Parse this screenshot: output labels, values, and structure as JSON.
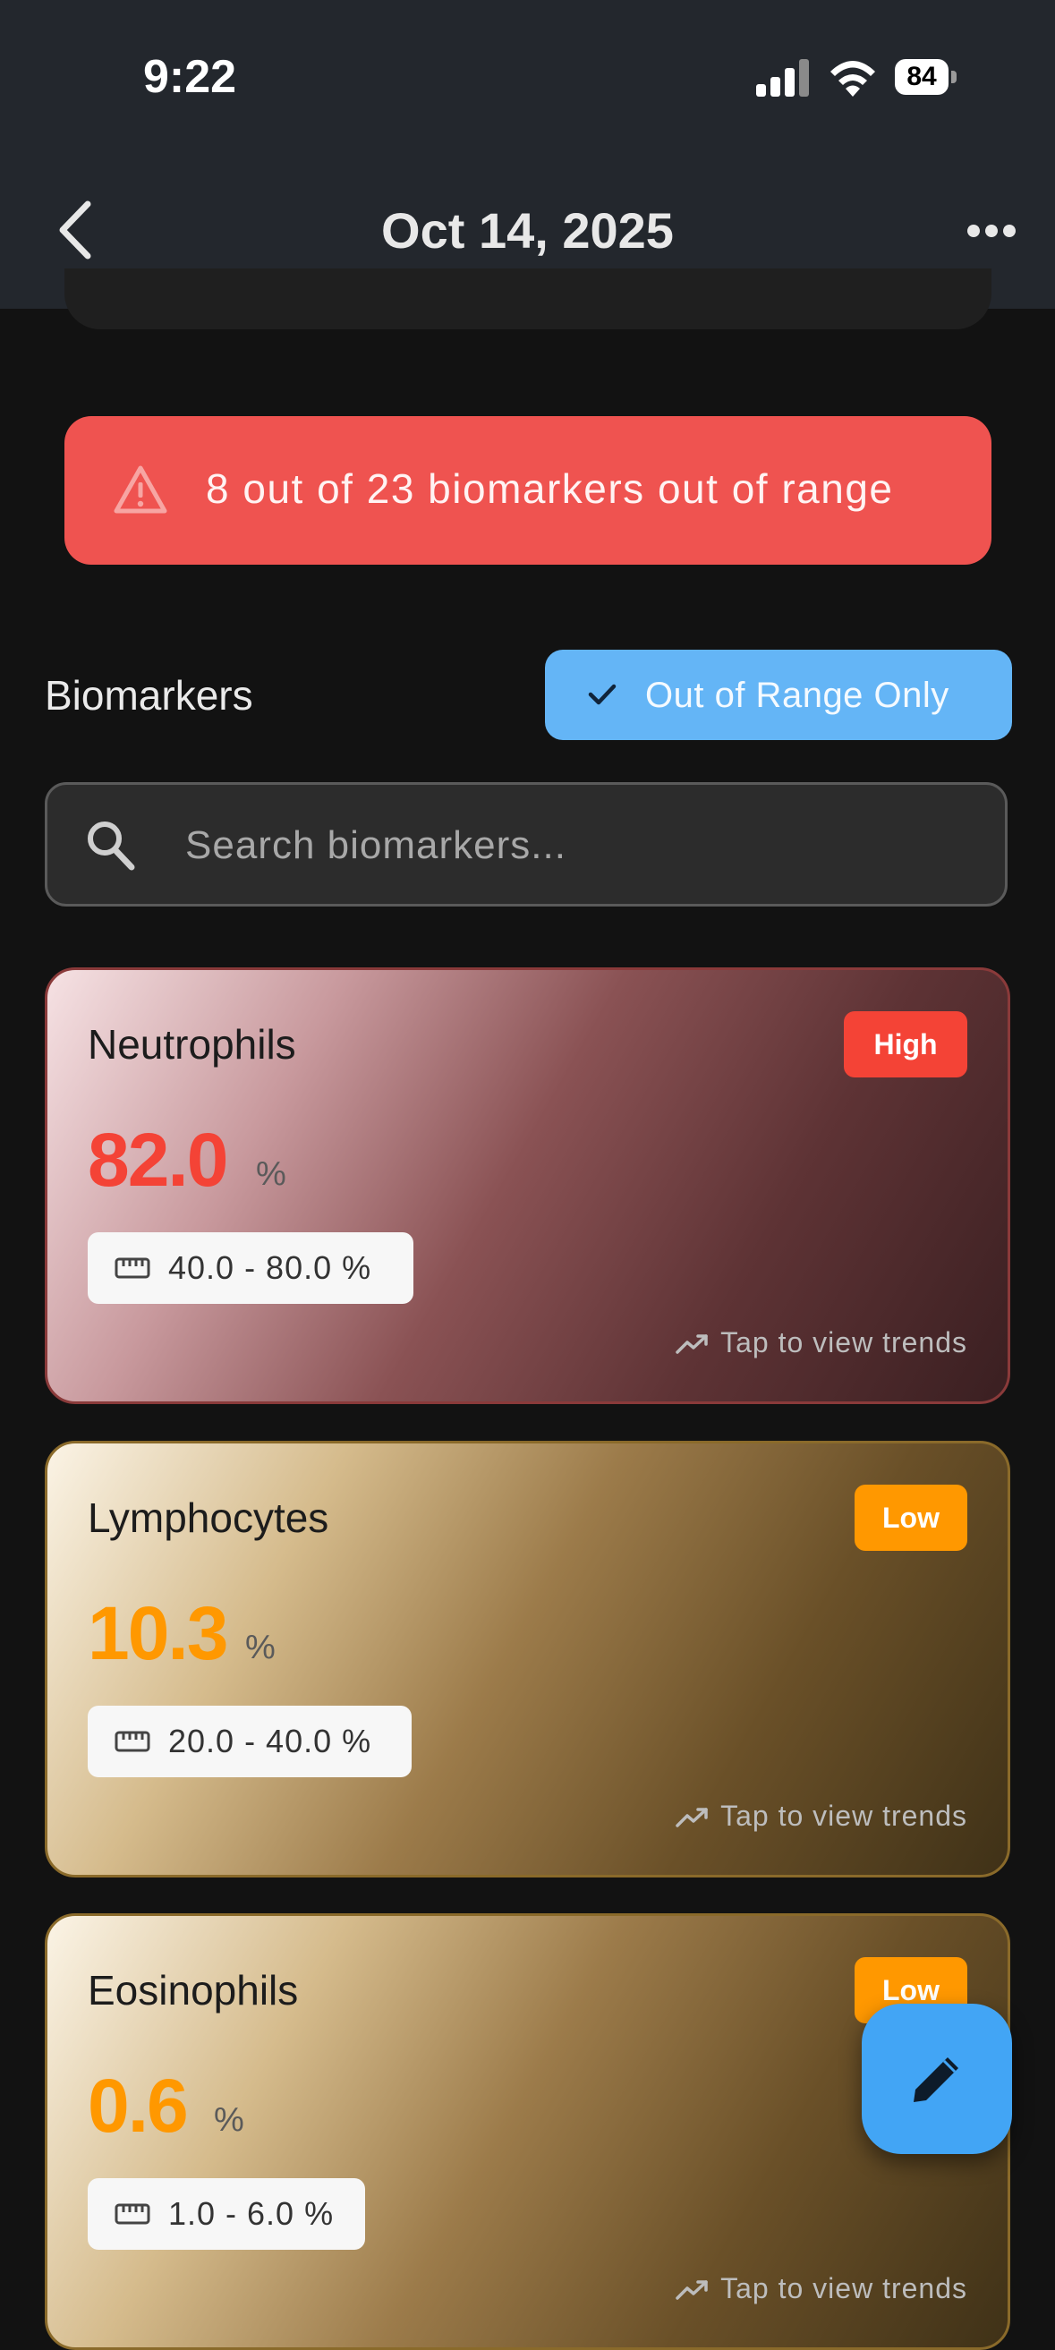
{
  "status_bar": {
    "time": "9:22",
    "battery": "84"
  },
  "nav": {
    "title": "Oct 14, 2025"
  },
  "alert": {
    "text": "8 out of 23 biomarkers out of range"
  },
  "biomarkers_section": {
    "title": "Biomarkers",
    "filter_label": "Out of Range Only",
    "search_placeholder": "Search biomarkers..."
  },
  "cards": [
    {
      "name": "Neutrophils",
      "status": "High",
      "value": "82.0",
      "unit": "%",
      "range": "40.0 - 80.0 %",
      "trend_label": "Tap to view trends"
    },
    {
      "name": "Lymphocytes",
      "status": "Low",
      "value": "10.3",
      "unit": "%",
      "range": "20.0 - 40.0 %",
      "trend_label": "Tap to view trends"
    },
    {
      "name": "Eosinophils",
      "status": "Low",
      "value": "0.6",
      "unit": "%",
      "range": "1.0 - 6.0 %",
      "trend_label": "Tap to view trends"
    }
  ],
  "colors": {
    "high": "#f44336",
    "low": "#ff9800",
    "alert": "#ef5350",
    "accent": "#64b5f6",
    "fab": "#42a5f5"
  },
  "icons": {
    "back": "chevron-left-icon",
    "more": "more-horizontal-icon",
    "alert": "warning-triangle-icon",
    "check": "check-icon",
    "search": "search-icon",
    "ruler": "ruler-icon",
    "trend": "trending-up-icon",
    "fab": "pencil-icon"
  }
}
